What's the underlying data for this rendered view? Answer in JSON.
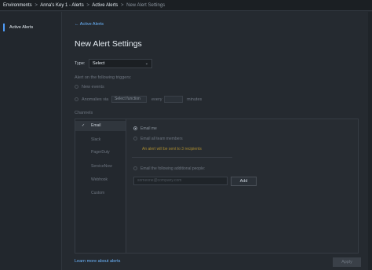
{
  "breadcrumb": {
    "items": [
      "Environments",
      "Anna's Key 1 - Alerts",
      "Active Alerts"
    ],
    "separator": ">",
    "current": "New Alert Settings"
  },
  "sidebar": {
    "items": [
      {
        "label": "Active Alerts"
      }
    ]
  },
  "back": {
    "arrow": "←",
    "label": "Active Alerts"
  },
  "title": "New Alert Settings",
  "type": {
    "label": "Type:",
    "value": "Select",
    "chevron": "⌄"
  },
  "triggers": {
    "heading": "Alert on the following triggers:",
    "new_events": "New events",
    "anomalies_prefix": "Anomalies via",
    "function_select": "Select function",
    "every": "every",
    "minutes": "minutes"
  },
  "channels": {
    "heading": "Channels",
    "check_mark": "✓",
    "items": [
      {
        "label": "Email"
      },
      {
        "label": "Slack"
      },
      {
        "label": "PagerDuty"
      },
      {
        "label": "ServiceNow"
      },
      {
        "label": "Webhook"
      },
      {
        "label": "Custom"
      }
    ],
    "email": {
      "email_me": "Email me",
      "all_team": "Email all team members",
      "note": "An alert will be sent to 3 recipients",
      "additional": "Email the following additional people:",
      "placeholder": "someone@company.com",
      "add_label": "Add"
    }
  },
  "footer": {
    "learn_more": "Learn more about alerts",
    "apply_label": "Apply"
  },
  "colors": {
    "accent": "#4f9cf9",
    "link": "#6cb6ff",
    "background": "#252a30",
    "warning": "#a88a2f"
  }
}
